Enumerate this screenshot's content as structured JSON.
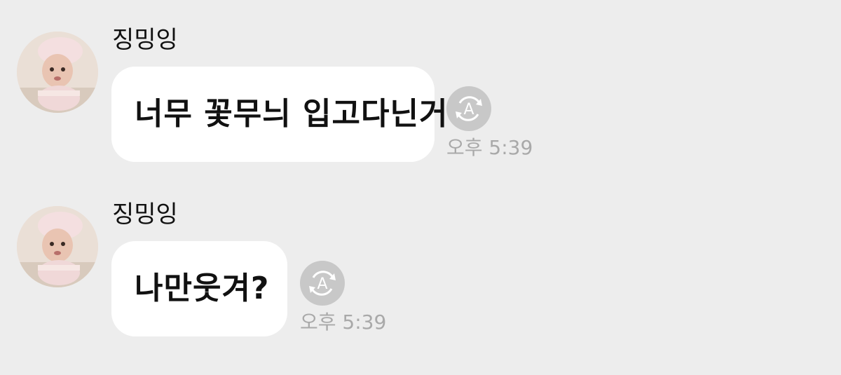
{
  "messages": [
    {
      "sender": "징밍잉",
      "text": "너무 꽃무늬 입고다닌거",
      "time": "오후 5:39",
      "avatar_icon": "baby-photo-avatar",
      "translate_icon": "auto-translate-icon"
    },
    {
      "sender": "징밍잉",
      "text": "나만웃겨?",
      "time": "오후 5:39",
      "avatar_icon": "baby-photo-avatar",
      "translate_icon": "auto-translate-icon"
    }
  ],
  "colors": {
    "background": "#ededed",
    "bubble": "#ffffff",
    "translate_button": "#c8c8c8",
    "timestamp": "#a9a9a9"
  }
}
